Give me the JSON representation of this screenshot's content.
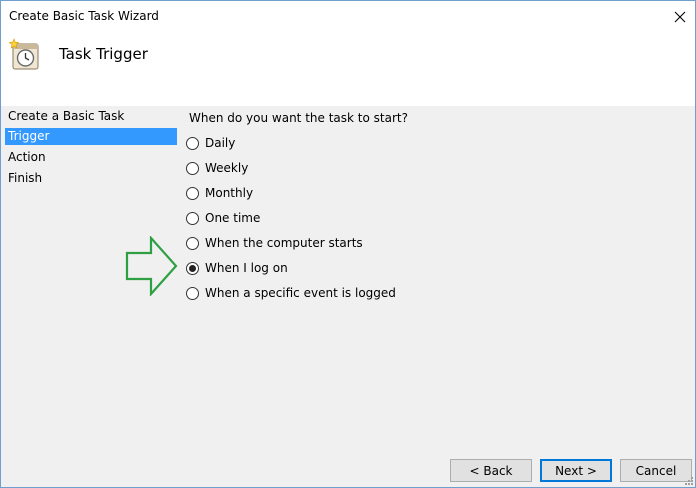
{
  "window": {
    "title": "Create Basic Task Wizard"
  },
  "header": {
    "title": "Task Trigger",
    "icon": "task-scheduler-clock-icon"
  },
  "sidebar": {
    "items": [
      {
        "label": "Create a Basic Task",
        "active": false
      },
      {
        "label": "Trigger",
        "active": true
      },
      {
        "label": "Action",
        "active": false
      },
      {
        "label": "Finish",
        "active": false
      }
    ]
  },
  "main": {
    "question": "When do you want the task to start?",
    "options": [
      {
        "label": "Daily",
        "checked": false
      },
      {
        "label": "Weekly",
        "checked": false
      },
      {
        "label": "Monthly",
        "checked": false
      },
      {
        "label": "One time",
        "checked": false
      },
      {
        "label": "When the computer starts",
        "checked": false
      },
      {
        "label": "When I log on",
        "checked": true
      },
      {
        "label": "When a specific event is logged",
        "checked": false
      }
    ]
  },
  "annotation": {
    "icon": "green-arrow-right-icon",
    "color": "#2ea043"
  },
  "buttons": {
    "back": "< Back",
    "next": "Next >",
    "cancel": "Cancel"
  },
  "colors": {
    "selection": "#3399ff",
    "border": "#6f9fcf",
    "default_button": "#0078d7"
  }
}
